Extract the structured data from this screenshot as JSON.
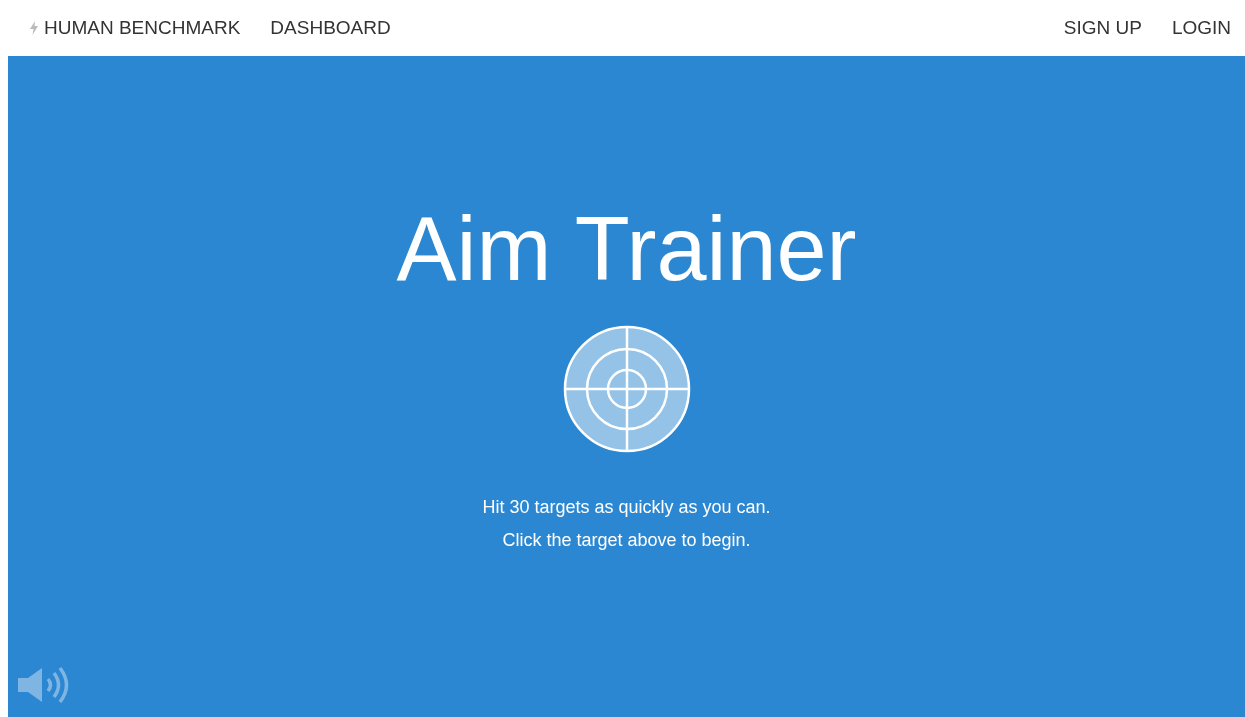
{
  "nav": {
    "brand": "HUMAN BENCHMARK",
    "left_links": [
      "DASHBOARD"
    ],
    "right_links": [
      "SIGN UP",
      "LOGIN"
    ]
  },
  "hero": {
    "title": "Aim Trainer",
    "lines": [
      "Hit 30 targets as quickly as you can.",
      "Click the target above to begin."
    ]
  }
}
